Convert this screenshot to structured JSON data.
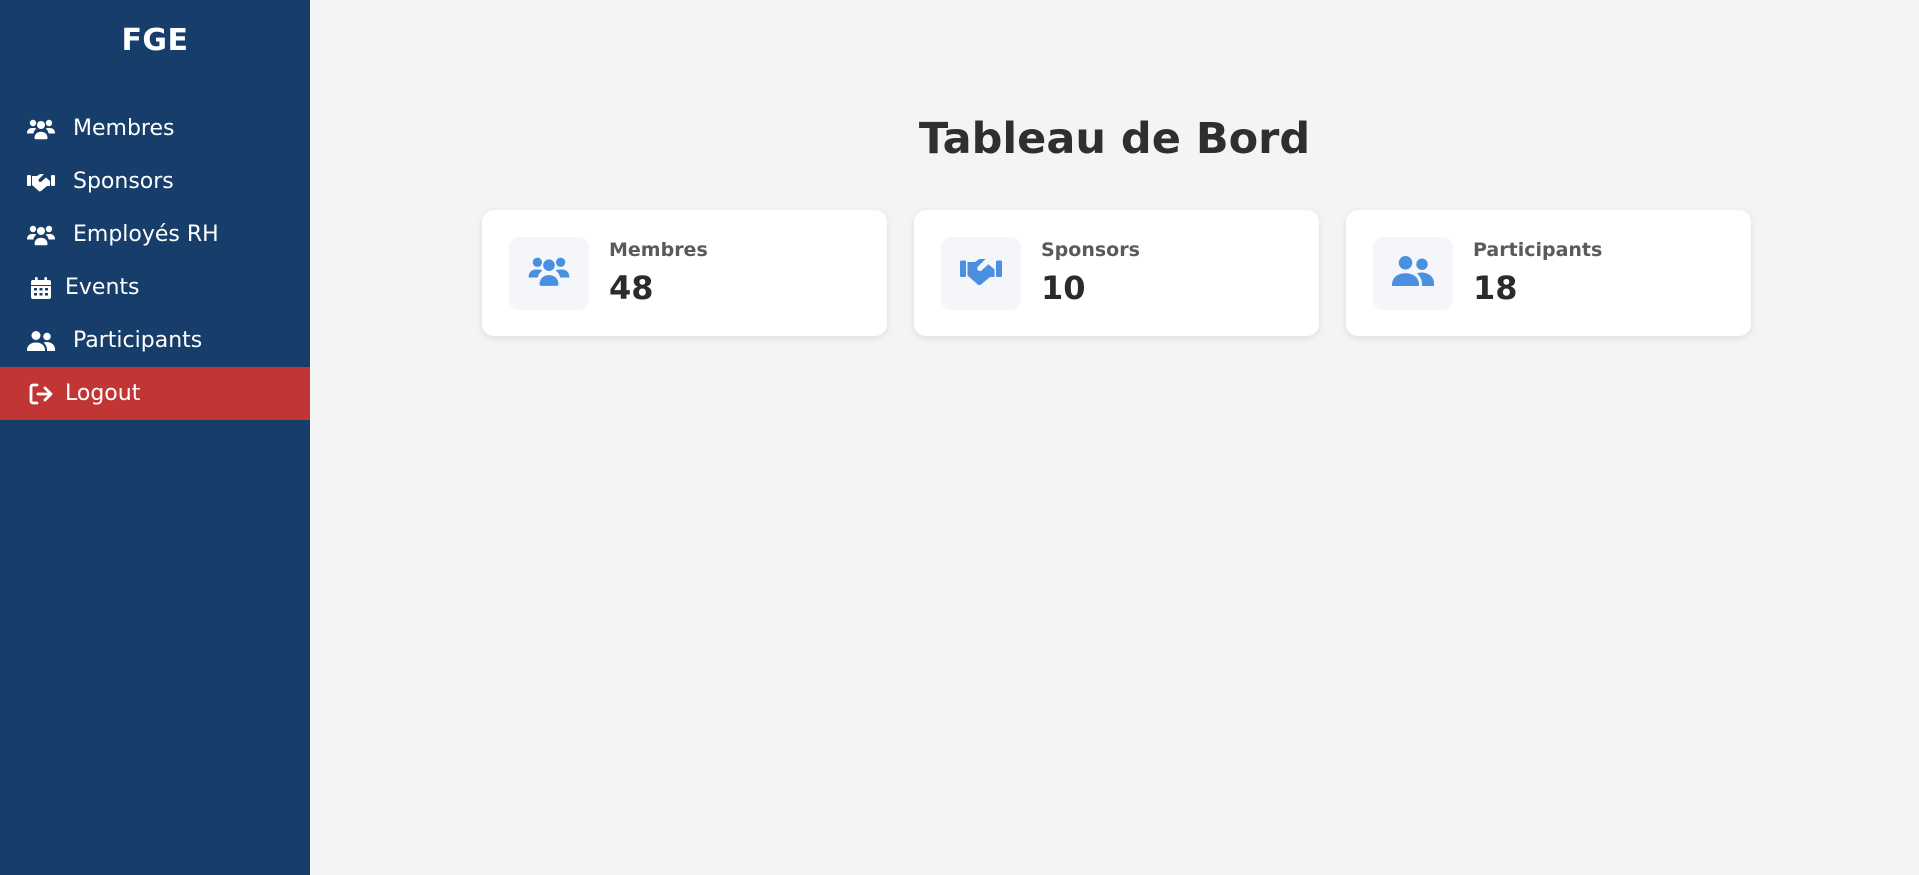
{
  "sidebar": {
    "brand": "FGE",
    "items": [
      {
        "label": "Membres",
        "icon": "users-icon"
      },
      {
        "label": "Sponsors",
        "icon": "handshake-icon"
      },
      {
        "label": "Employés RH",
        "icon": "users-icon"
      },
      {
        "label": "Events",
        "icon": "calendar-icon"
      },
      {
        "label": "Participants",
        "icon": "user-friends-icon"
      },
      {
        "label": "Logout",
        "icon": "sign-out-icon"
      }
    ]
  },
  "main": {
    "title": "Tableau de Bord",
    "cards": [
      {
        "label": "Membres",
        "value": "48",
        "icon": "users-icon"
      },
      {
        "label": "Sponsors",
        "value": "10",
        "icon": "handshake-icon"
      },
      {
        "label": "Participants",
        "value": "18",
        "icon": "user-friends-icon"
      }
    ]
  },
  "colors": {
    "sidebar": "#173e6b",
    "logout": "#c23535",
    "accent_icon": "#4a8fe0",
    "background": "#f4f4f4"
  }
}
